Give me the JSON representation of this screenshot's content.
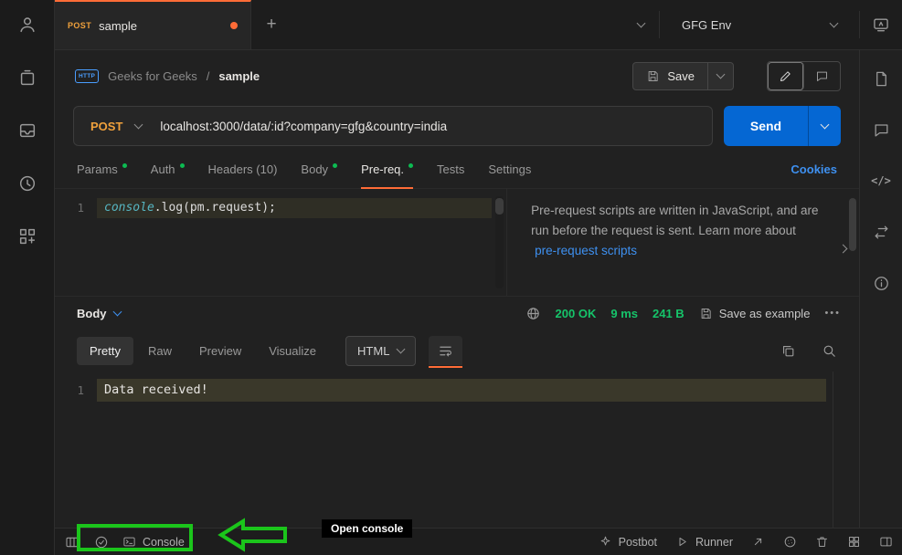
{
  "colors": {
    "accent_orange": "#ff6c37",
    "method_orange": "#f0a13c",
    "link_blue": "#3e90f0",
    "success_green": "#16c46a",
    "annotation_green": "#1bc51b"
  },
  "tabbar": {
    "tab": {
      "method": "POST",
      "title": "sample"
    },
    "new_tab_glyph": "+",
    "env_name": "GFG Env"
  },
  "breadcrumb": {
    "http_badge": "HTTP",
    "workspace": "Geeks for Geeks",
    "separator": "/",
    "request_name": "sample"
  },
  "toolbar": {
    "save_label": "Save"
  },
  "request_bar": {
    "method": "POST",
    "url": "localhost:3000/data/:id?company=gfg&country=india",
    "send_label": "Send"
  },
  "request_tabs": {
    "items": [
      {
        "label": "Params"
      },
      {
        "label": "Auth"
      },
      {
        "label": "Headers (10)"
      },
      {
        "label": "Body"
      },
      {
        "label": "Pre-req."
      },
      {
        "label": "Tests"
      },
      {
        "label": "Settings"
      }
    ],
    "cookies_link": "Cookies"
  },
  "script_editor": {
    "line_number": "1",
    "code_object": "console",
    "code_rest": ".log(pm.request);"
  },
  "help_panel": {
    "text_before": "Pre-request scripts are written in JavaScript, and are run before the request is sent. Learn more about",
    "link": "pre-request scripts"
  },
  "response": {
    "body_label": "Body",
    "status": "200 OK",
    "time": "9 ms",
    "size": "241 B",
    "save_as_example": "Save as example",
    "more_glyph": "•••",
    "tabs": [
      {
        "label": "Pretty"
      },
      {
        "label": "Raw"
      },
      {
        "label": "Preview"
      },
      {
        "label": "Visualize"
      }
    ],
    "format": "HTML",
    "line_number": "1",
    "body_content": "Data received!"
  },
  "footer": {
    "console_label": "Console",
    "postbot_label": "Postbot",
    "runner_label": "Runner"
  },
  "rail_right": {
    "code_glyph": "</>"
  },
  "annotation": {
    "tooltip": "Open console"
  }
}
